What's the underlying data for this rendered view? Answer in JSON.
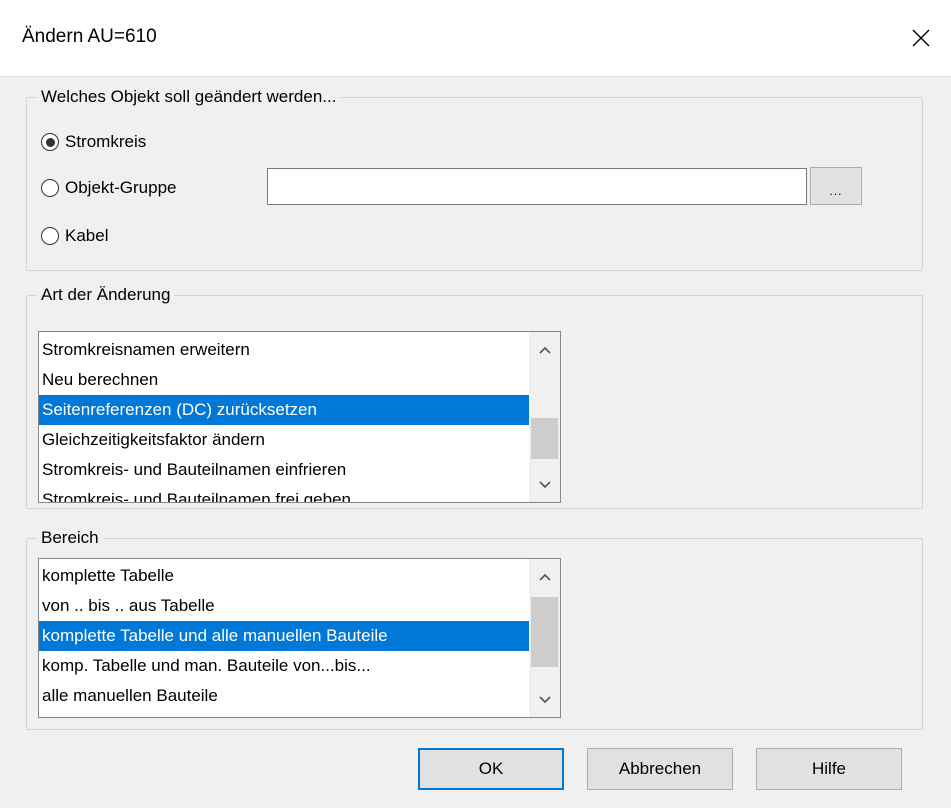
{
  "window": {
    "title": "Ändern  AU=610"
  },
  "object_group": {
    "legend": "Welches Objekt soll geändert werden...",
    "options": [
      {
        "label": "Stromkreis",
        "checked": true
      },
      {
        "label": "Objekt-Gruppe",
        "checked": false
      },
      {
        "label": "Kabel",
        "checked": false
      }
    ],
    "group_field_value": "",
    "browse_label": "..."
  },
  "change_group": {
    "legend": "Art der Änderung",
    "items": [
      "Stromkreisnamen erweitern",
      "Neu berechnen",
      "Seitenreferenzen (DC) zurücksetzen",
      "Gleichzeitigkeitsfaktor ändern",
      "Stromkreis- und Bauteilnamen einfrieren",
      "Stromkreis- und Bauteilnamen frei geben"
    ],
    "selected_item": "Seitenreferenzen (DC) zurücksetzen"
  },
  "range_group": {
    "legend": "Bereich",
    "items": [
      "komplette Tabelle",
      "von .. bis .. aus Tabelle",
      "komplette Tabelle und alle manuellen Bauteile",
      "komp. Tabelle und man. Bauteile von...bis...",
      "alle manuellen Bauteile"
    ],
    "selected_item": "komplette Tabelle und alle manuellen Bauteile"
  },
  "buttons": {
    "ok": "OK",
    "cancel": "Abbrechen",
    "help": "Hilfe"
  },
  "icons": {
    "close": "close-icon",
    "scroll_up": "chevron-up-icon",
    "scroll_down": "chevron-down-icon"
  },
  "colors": {
    "selection": "#0078d7",
    "default_button_border": "#0078d7"
  }
}
